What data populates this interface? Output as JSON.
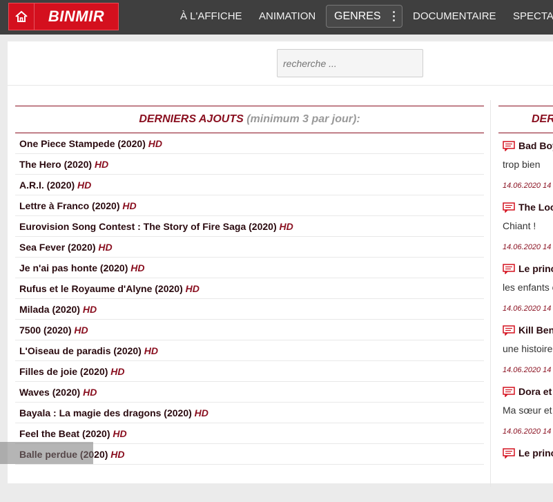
{
  "brand": {
    "name": "BINMIR"
  },
  "nav": {
    "items": [
      "À L'AFFICHE",
      "ANIMATION",
      "DOCUMENTAIRE",
      "SPECTA"
    ],
    "genres_label": "GENRES"
  },
  "search": {
    "placeholder": "recherche ..."
  },
  "latest": {
    "title": "DERNIERS AJOUTS",
    "subtitle": "(minimum 3 par jour):",
    "movies": [
      {
        "title": "One Piece Stampede (2020)",
        "quality": "HD"
      },
      {
        "title": "The Hero (2020)",
        "quality": "HD"
      },
      {
        "title": "A.R.I. (2020)",
        "quality": "HD"
      },
      {
        "title": "Lettre à Franco (2020)",
        "quality": "HD"
      },
      {
        "title": "Eurovision Song Contest : The Story of Fire Saga (2020)",
        "quality": "HD"
      },
      {
        "title": "Sea Fever (2020)",
        "quality": "HD"
      },
      {
        "title": "Je n'ai pas honte (2020)",
        "quality": "HD"
      },
      {
        "title": "Rufus et le Royaume d'Alyne (2020)",
        "quality": "HD"
      },
      {
        "title": "Milada (2020)",
        "quality": "HD"
      },
      {
        "title": "7500 (2020)",
        "quality": "HD"
      },
      {
        "title": "L'Oiseau de paradis (2020)",
        "quality": "HD"
      },
      {
        "title": "Filles de joie (2020)",
        "quality": "HD"
      },
      {
        "title": "Waves (2020)",
        "quality": "HD"
      },
      {
        "title": "Bayala : La magie des dragons (2020)",
        "quality": "HD"
      },
      {
        "title": "Feel the Beat (2020)",
        "quality": "HD"
      },
      {
        "title": "Balle perdue (2020)",
        "quality": "HD"
      }
    ]
  },
  "comments": {
    "title": "DER",
    "items": [
      {
        "title": "Bad Boy",
        "text": "trop bien",
        "date": "14.06.2020 14"
      },
      {
        "title": "The Loc",
        "text": "Chiant !",
        "date": "14.06.2020 14"
      },
      {
        "title": "Le princ",
        "text": "les enfants o",
        "date": "14.06.2020 14"
      },
      {
        "title": "Kill Ben",
        "text": "une histoire",
        "date": "14.06.2020 14"
      },
      {
        "title": "Dora et",
        "text": "Ma sœur et",
        "date": "14.06.2020 14"
      },
      {
        "title": "Le princ",
        "text": "",
        "date": ""
      }
    ]
  },
  "colors": {
    "brand_red": "#d4101e",
    "accent": "#8a1020",
    "navbar": "#3f3f3f"
  },
  "icons": {
    "home": "home-icon",
    "comment": "comment-icon",
    "menu": "kebab-menu-icon"
  }
}
